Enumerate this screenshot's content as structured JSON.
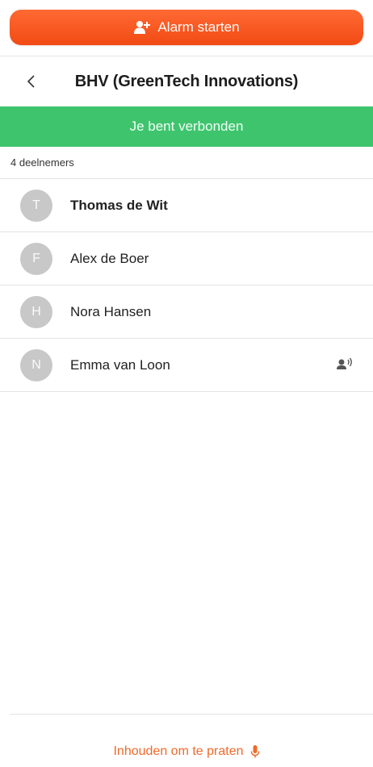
{
  "alarm": {
    "label": "Alarm starten",
    "icon": "person-alert-icon",
    "color": "#f4511e"
  },
  "header": {
    "back_icon": "chevron-left-icon",
    "title": "BHV (GreenTech Innovations)"
  },
  "banner": {
    "text": "Je bent verbonden",
    "color": "#3fc46e"
  },
  "participants": {
    "count_label": "4 deelnemers",
    "items": [
      {
        "initial": "T",
        "name": "Thomas de Wit",
        "bold": true,
        "speaking": false
      },
      {
        "initial": "F",
        "name": "Alex de Boer",
        "bold": false,
        "speaking": false
      },
      {
        "initial": "H",
        "name": "Nora Hansen",
        "bold": false,
        "speaking": false
      },
      {
        "initial": "N",
        "name": "Emma van Loon",
        "bold": false,
        "speaking": true
      }
    ]
  },
  "push_to_talk": {
    "label": "Inhouden om te praten",
    "icon": "microphone-icon",
    "color": "#f06a2a"
  }
}
